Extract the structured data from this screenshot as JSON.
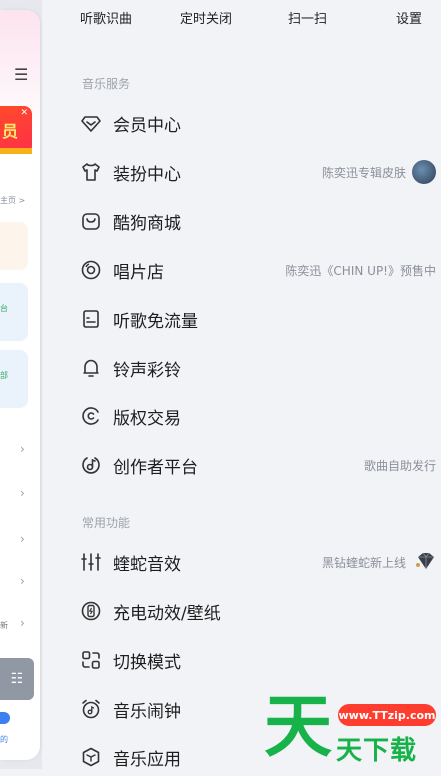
{
  "top_actions": [
    "听歌识曲",
    "定时关闭",
    "扫一扫",
    "设置"
  ],
  "sections": [
    {
      "title": "音乐服务",
      "items": [
        {
          "label": "会员中心",
          "icon": "diamond-icon",
          "sub": ""
        },
        {
          "label": "装扮中心",
          "icon": "shirt-icon",
          "sub": "陈奕迅专辑皮肤"
        },
        {
          "label": "酷狗商城",
          "icon": "shopping-bag-icon",
          "sub": ""
        },
        {
          "label": "唱片店",
          "icon": "vinyl-record-icon",
          "sub": "陈奕迅《CHIN UP!》预售中"
        },
        {
          "label": "听歌免流量",
          "icon": "sim-card-icon",
          "sub": ""
        },
        {
          "label": "铃声彩铃",
          "icon": "bell-icon",
          "sub": ""
        },
        {
          "label": "版权交易",
          "icon": "copyright-icon",
          "sub": ""
        },
        {
          "label": "创作者平台",
          "icon": "music-note-icon",
          "sub": "歌曲自助发行"
        }
      ]
    },
    {
      "title": "常用功能",
      "items": [
        {
          "label": "蝰蛇音效",
          "icon": "equalizer-icon",
          "sub": "黑钻蝰蛇新上线"
        },
        {
          "label": "充电动效/壁纸",
          "icon": "charging-icon",
          "sub": ""
        },
        {
          "label": "切换模式",
          "icon": "mode-switch-icon",
          "sub": ""
        },
        {
          "label": "音乐闹钟",
          "icon": "alarm-clock-icon",
          "sub": ""
        },
        {
          "label": "音乐应用",
          "icon": "app-cube-icon",
          "sub": ""
        }
      ]
    }
  ],
  "left_peek": {
    "vip_text": "员",
    "homepage_link": "主页 >",
    "snippet_a": "台",
    "snippet_b": "部",
    "snippet_c": "新",
    "snippet_d": "的"
  },
  "watermark": {
    "url": "www.TTzip.com",
    "big_char": "天",
    "brand": "天下载"
  },
  "colors": {
    "background": "#f2f3f6",
    "text": "#1e1e1e",
    "secondary_text": "#8a8f99",
    "section_title": "#9ea3ab",
    "watermark_green": "#17b34a",
    "watermark_red": "#ff3d2e"
  }
}
